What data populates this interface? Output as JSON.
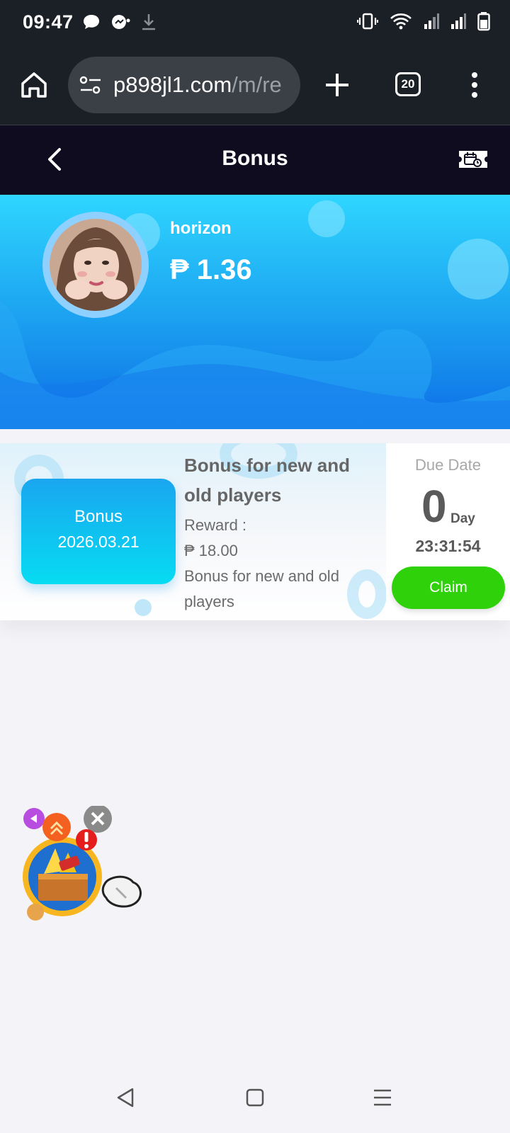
{
  "status_bar": {
    "time": "09:47"
  },
  "browser": {
    "url_main": "p898jl1.com",
    "url_path": "/m/re",
    "tab_count": "20"
  },
  "header": {
    "title": "Bonus"
  },
  "profile": {
    "username": "horizon",
    "balance": "₱ 1.36"
  },
  "bonus_card": {
    "tile_label": "Bonus",
    "tile_date": "2026.03.21",
    "title": "Bonus for new and old players",
    "reward_label": "Reward :",
    "reward_amount": "₱ 18.00",
    "description": "Bonus for new and old players",
    "due_label": "Due Date",
    "due_days": "0",
    "due_day_unit": "Day",
    "due_time": "23:31:54",
    "claim_label": "Claim"
  },
  "colors": {
    "banner_top": "#2fd6ff",
    "banner_bottom": "#0d6ee6",
    "claim_button": "#2fd10a",
    "header_bg": "#0f0c1f"
  },
  "icons": [
    "vibrate-icon",
    "wifi-icon",
    "signal-icon",
    "battery-icon",
    "home-icon",
    "tune-icon",
    "plus-icon",
    "tabs-icon",
    "more-vert-icon",
    "back-arrow-icon",
    "ticket-icon",
    "treasure-chest-icon",
    "close-icon",
    "nav-back-icon",
    "nav-home-icon",
    "nav-menu-icon"
  ]
}
